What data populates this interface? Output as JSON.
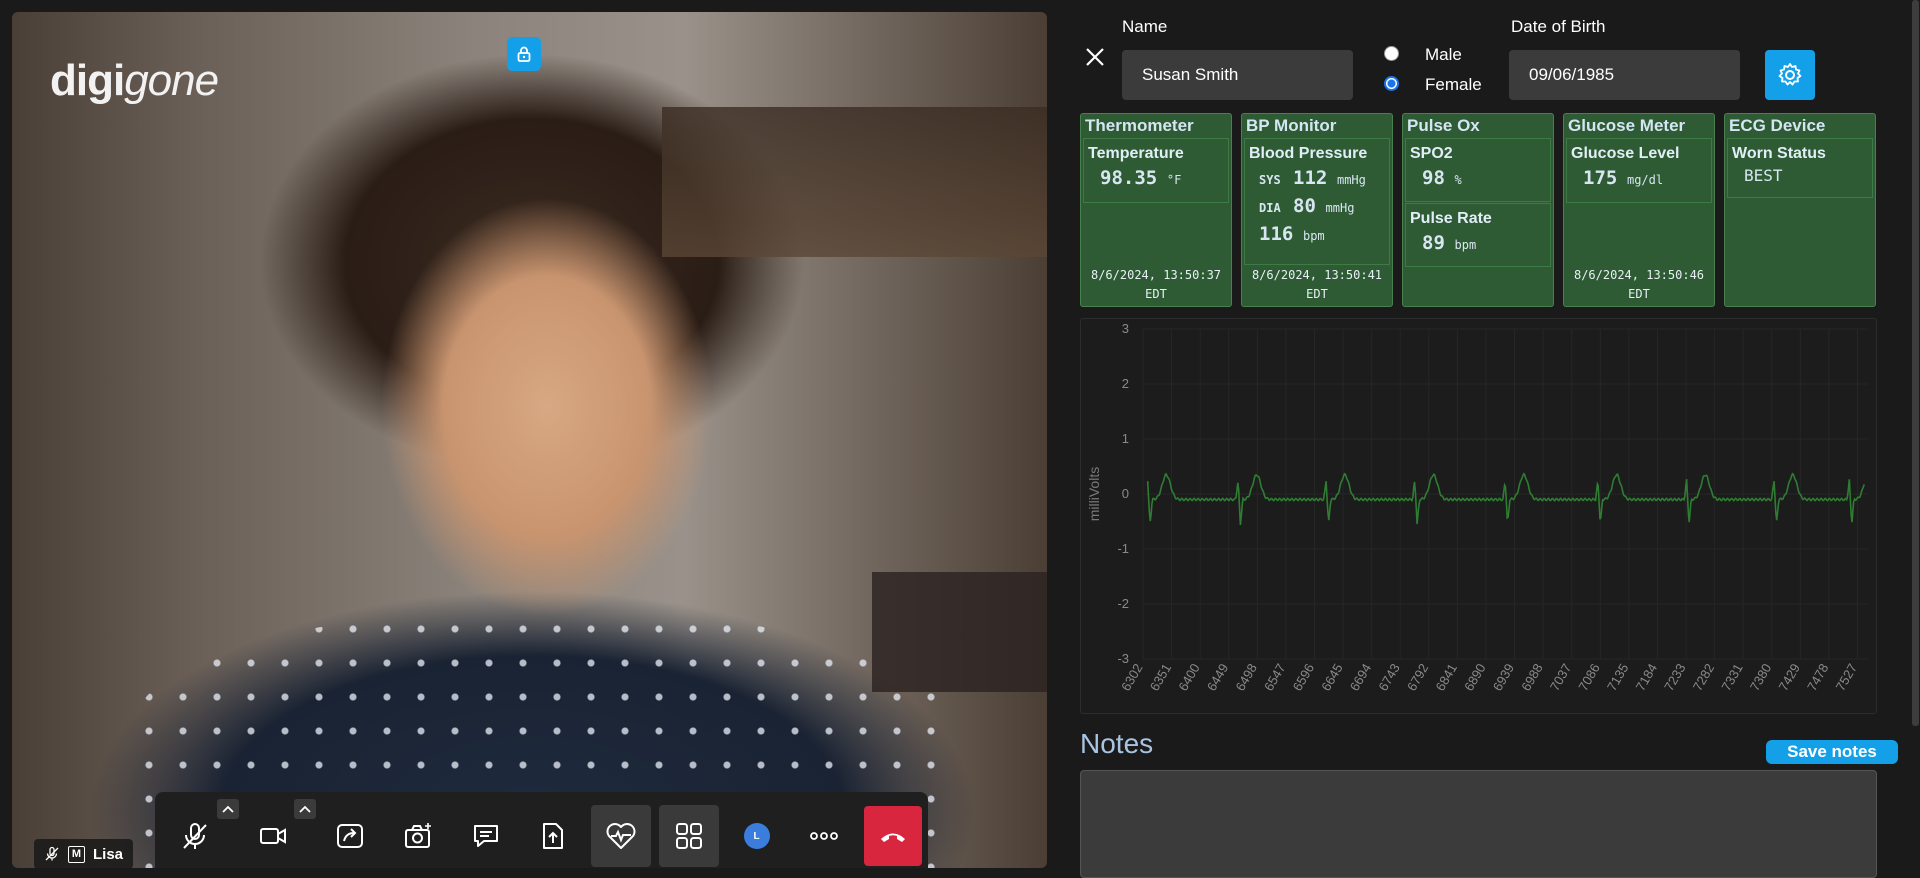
{
  "video": {
    "logo_bold": "digi",
    "logo_light": "gone",
    "participant_name": "Lisa",
    "mic_state_badge": "M"
  },
  "toolbar": {
    "underline_colors": {
      "share": "#e8c70f",
      "capture": "#18b85a",
      "chat": "#2f86d6",
      "upload": "#5b4dbf",
      "vitals": "#c8232c"
    },
    "avatar_initial": "L",
    "icons": [
      "mic-muted-icon",
      "video-camera-icon",
      "share-screen-icon",
      "camera-capture-icon",
      "chat-icon",
      "upload-file-icon",
      "heart-vitals-icon",
      "grid-layout-icon",
      "participant-avatar",
      "more-icon",
      "hang-up-icon"
    ]
  },
  "patient": {
    "name_label": "Name",
    "name_value": "Susan Smith",
    "gender_options": [
      "Male",
      "Female"
    ],
    "gender_selected": "Female",
    "dob_label": "Date of Birth",
    "dob_value": "09/06/1985"
  },
  "devices": {
    "thermometer": {
      "title": "Thermometer",
      "metric": "Temperature",
      "value": "98.35",
      "unit": "°F",
      "date": "8/6/2024, 13:50:37",
      "tz": "EDT"
    },
    "bp": {
      "title": "BP Monitor",
      "metric": "Blood Pressure",
      "sys_label": "SYS",
      "sys_value": "112",
      "dia_label": "DIA",
      "dia_value": "80",
      "bp_unit": "mmHg",
      "pulse_value": "116",
      "pulse_unit": "bpm",
      "date": "8/6/2024, 13:50:41",
      "tz": "EDT"
    },
    "pulseox": {
      "title": "Pulse Ox",
      "spo2_label": "SPO2",
      "spo2_value": "98",
      "spo2_unit": "%",
      "rate_label": "Pulse Rate",
      "rate_value": "89",
      "rate_unit": "bpm"
    },
    "glucose": {
      "title": "Glucose Meter",
      "metric": "Glucose Level",
      "value": "175",
      "unit": "mg/dl",
      "date": "8/6/2024, 13:50:46",
      "tz": "EDT"
    },
    "ecg": {
      "title": "ECG Device",
      "metric": "Worn Status",
      "value": "BEST"
    }
  },
  "chart_data": {
    "type": "line",
    "ylabel": "milliVolts",
    "ylim": [
      -3,
      3
    ],
    "yticks": [
      3,
      2,
      1,
      0,
      -1,
      -2,
      -3
    ],
    "xticks": [
      6302,
      6351,
      6400,
      6449,
      6498,
      6547,
      6596,
      6645,
      6694,
      6743,
      6792,
      6841,
      6890,
      6939,
      6988,
      7037,
      7086,
      7135,
      7184,
      7233,
      7282,
      7331,
      7380,
      7429,
      7478,
      7527
    ],
    "xlim": [
      6302,
      7545
    ],
    "beat_x": [
      6312,
      6467,
      6618,
      6770,
      6925,
      7084,
      7236,
      7386,
      7515
    ],
    "beat_spike_high": 0.35,
    "beat_spike_low": -0.45,
    "t_wave_peak": 0.45,
    "baseline": -0.1,
    "series_color": "#2e7d32"
  },
  "notes": {
    "title": "Notes",
    "save_label": "Save notes"
  }
}
